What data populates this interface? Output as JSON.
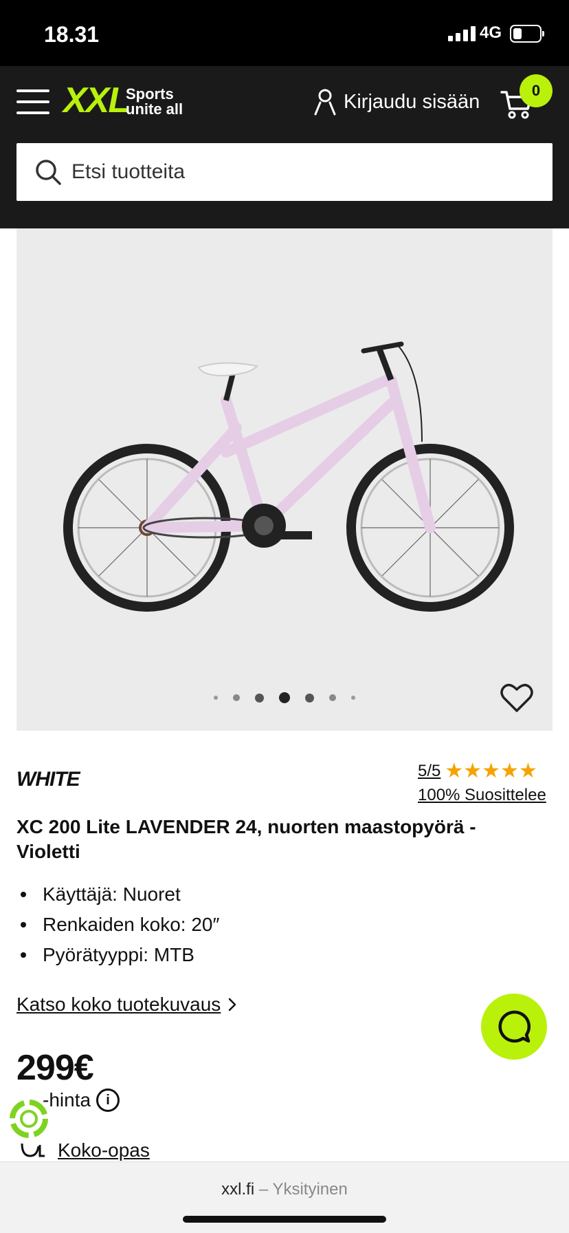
{
  "status_bar": {
    "time": "18.31",
    "network": "4G"
  },
  "header": {
    "logo": "XXL",
    "tagline_line1": "Sports",
    "tagline_line2": "unite all",
    "login_label": "Kirjaudu sisään",
    "cart_count": "0"
  },
  "search": {
    "placeholder": "Etsi tuotteita"
  },
  "gallery": {
    "dot_count": 7,
    "active_dot": 3
  },
  "product": {
    "brand": "WHITE",
    "rating_score": "5/5",
    "stars": "★★★★★",
    "recommend": "100% Suosittelee",
    "title": "XC 200 Lite LAVENDER 24, nuorten maastopyörä - Violetti",
    "features": [
      "Käyttäjä: Nuoret",
      "Renkaiden koko: 20″",
      "Pyörätyyppi: MTB"
    ],
    "description_link": "Katso koko tuotekuvaus",
    "price": "299€",
    "price_note": "-hinta",
    "size_guide": "Koko-opas"
  },
  "browser": {
    "domain": "xxl.fi",
    "separator": "–",
    "mode": "Yksityinen"
  },
  "colors": {
    "brand_green": "#b9f10b",
    "header_bg": "#1a1a1a",
    "star": "#f5a300"
  }
}
